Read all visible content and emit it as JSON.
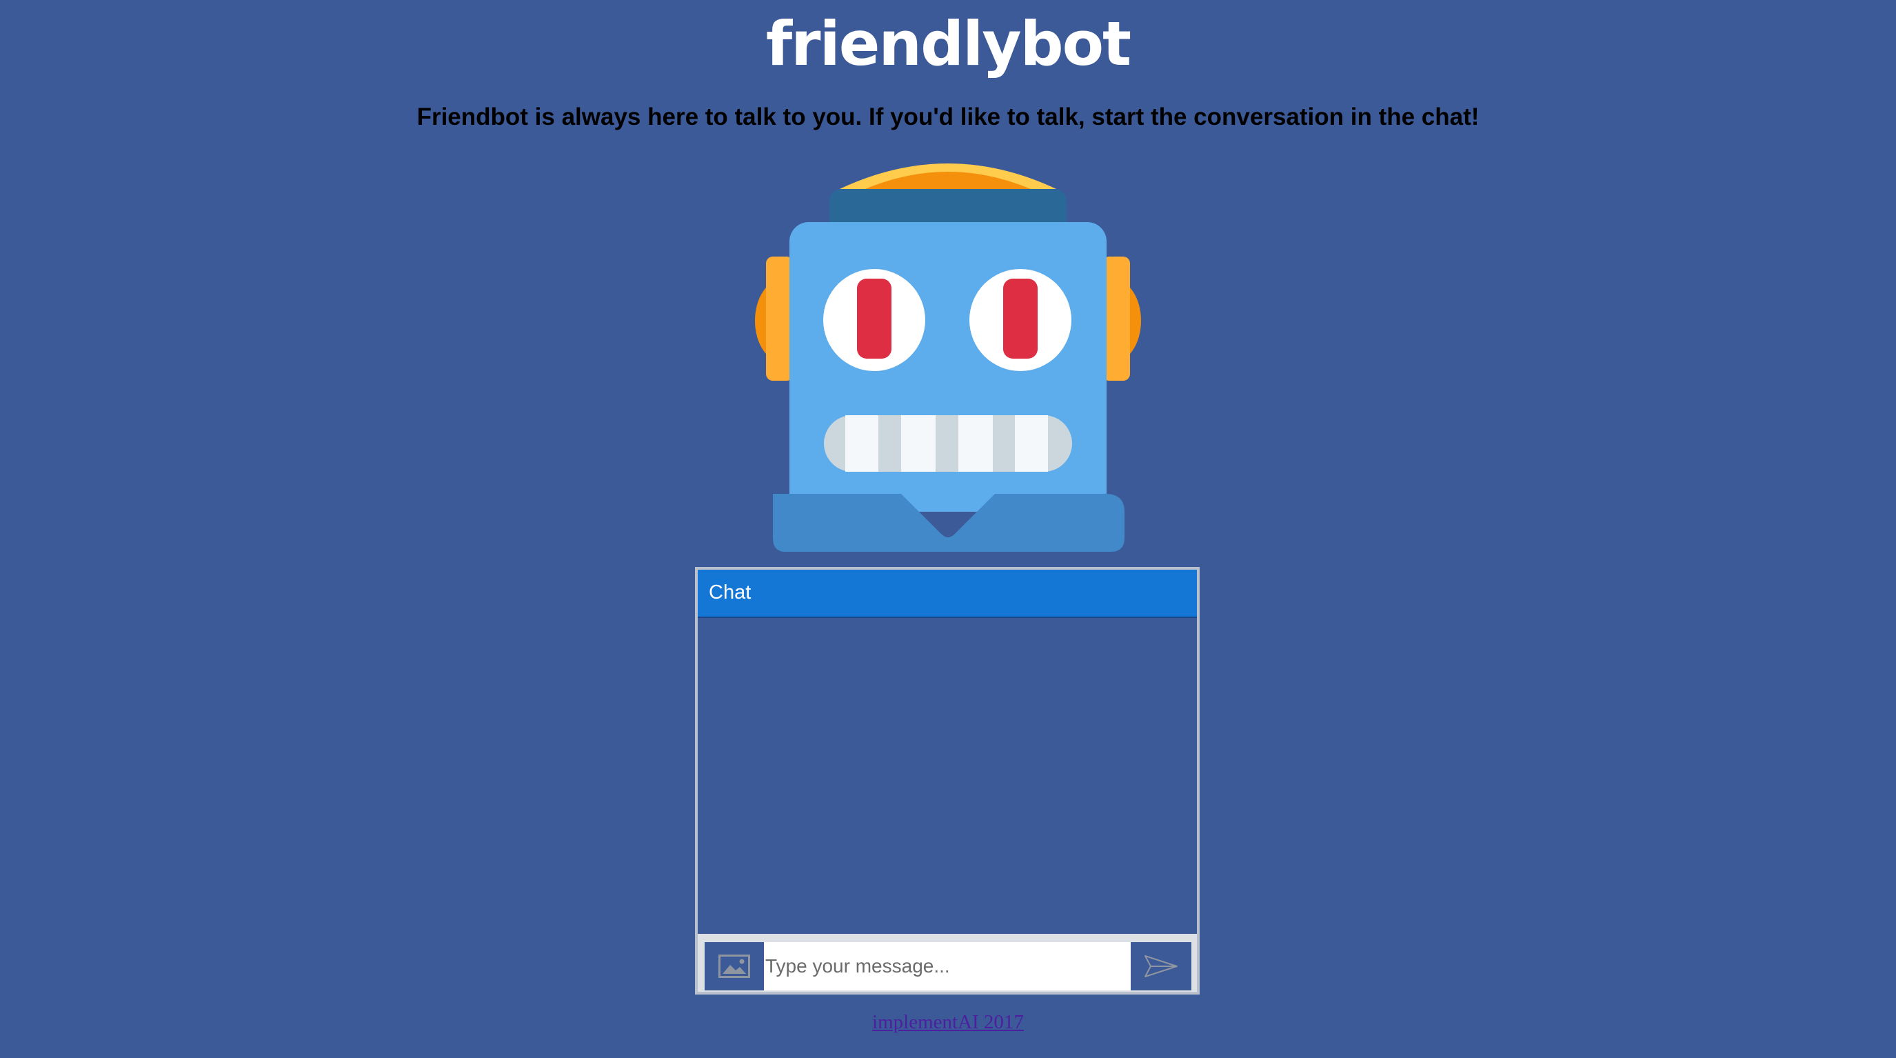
{
  "header": {
    "title": "friendlybot",
    "subtitle": "Friendbot is always here to talk to you. If you'd like to talk, start the conversation in the chat!"
  },
  "robot": {
    "icon": "robot-face-icon",
    "colors": {
      "face": "#5dadec",
      "headband": "#2a6898",
      "ears": "#f4900c",
      "ear_inner": "#ffac33",
      "top_dome": "#ffcc4d",
      "eyes_white": "#ffffff",
      "pupils": "#dd2e44",
      "teeth": "#f5f8fa",
      "teeth_gaps": "#ccd6dd",
      "body": "#4289c9"
    }
  },
  "chat": {
    "header_title": "Chat",
    "input_placeholder": "Type your message...",
    "input_value": "",
    "image_button_icon": "image-icon",
    "send_button_icon": "send-icon",
    "messages": []
  },
  "footer": {
    "link_text": "implementAI 2017"
  },
  "colors": {
    "page_background": "#3d5a98",
    "chat_header": "#1477d6",
    "link": "#4b1f9e"
  }
}
